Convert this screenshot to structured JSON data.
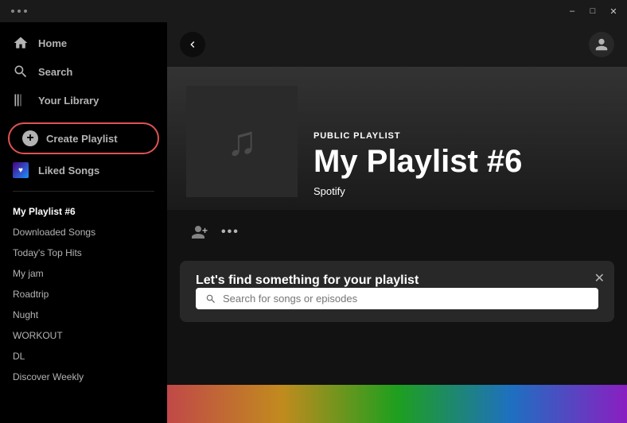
{
  "titleBar": {
    "dots": 3,
    "minimizeLabel": "–",
    "maximizeLabel": "□",
    "closeLabel": "✕"
  },
  "sidebar": {
    "navItems": [
      {
        "id": "home",
        "label": "Home",
        "icon": "⌂"
      },
      {
        "id": "search",
        "label": "Search",
        "icon": "🔍"
      },
      {
        "id": "library",
        "label": "Your Library",
        "icon": "|||"
      }
    ],
    "createPlaylist": "Create Playlist",
    "likedSongs": "Liked Songs",
    "playlists": [
      {
        "id": "my-playlist-6",
        "label": "My Playlist #6",
        "active": true
      },
      {
        "id": "downloaded-songs",
        "label": "Downloaded Songs",
        "active": false
      },
      {
        "id": "todays-top-hits",
        "label": "Today's Top Hits",
        "active": false
      },
      {
        "id": "my-jam",
        "label": "My jam",
        "active": false
      },
      {
        "id": "roadtrip",
        "label": "Roadtrip",
        "active": false
      },
      {
        "id": "nught",
        "label": "Nught",
        "active": false
      },
      {
        "id": "workout",
        "label": "WORKOUT",
        "active": false
      },
      {
        "id": "dl",
        "label": "DL",
        "active": false
      },
      {
        "id": "discover-weekly",
        "label": "Discover Weekly",
        "active": false
      }
    ]
  },
  "topNav": {
    "backIcon": "‹",
    "userIcon": "👤"
  },
  "playlist": {
    "type": "PUBLIC PLAYLIST",
    "name": "My Playlist #6",
    "owner": "Spotify"
  },
  "findSongs": {
    "title": "Let's find something for your playlist",
    "searchPlaceholder": "Search for songs or episodes",
    "closeIcon": "✕"
  },
  "icons": {
    "musicNote": "♫",
    "addUser": "⊕",
    "more": "•••",
    "search": "🔍",
    "back": "❮",
    "plus": "+"
  }
}
